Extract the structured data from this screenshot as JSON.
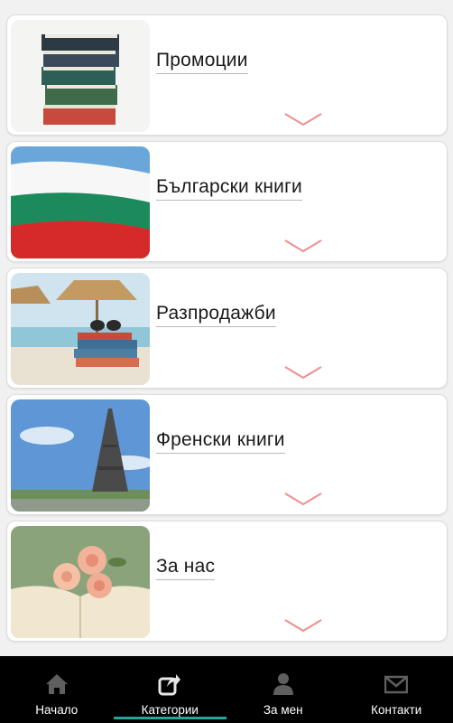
{
  "categories": [
    {
      "title": "Промоции",
      "image": "stacked-books"
    },
    {
      "title": "Български книги",
      "image": "bulgarian-flag"
    },
    {
      "title": "Разпродажби",
      "image": "beach-books"
    },
    {
      "title": "Френски книги",
      "image": "eiffel-tower"
    },
    {
      "title": "За нас",
      "image": "roses-on-book"
    }
  ],
  "chevron_icon": "chevron-down-icon",
  "colors": {
    "chevron": "#f08c8c",
    "nav_background": "#000000",
    "nav_active_underline": "#26a69a",
    "nav_icon": "#5f5f5f"
  },
  "nav": {
    "items": [
      {
        "label": "Начало",
        "icon": "home-icon"
      },
      {
        "label": "Категории",
        "icon": "external-share-icon",
        "active": true
      },
      {
        "label": "За мен",
        "icon": "person-icon"
      },
      {
        "label": "Контакти",
        "icon": "mail-icon"
      }
    ]
  }
}
